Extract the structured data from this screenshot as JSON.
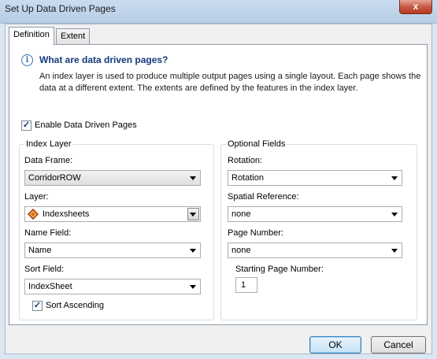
{
  "window": {
    "title": "Set Up Data Driven Pages",
    "close_glyph": "x"
  },
  "tabs": [
    {
      "label": "Definition",
      "active": true
    },
    {
      "label": "Extent",
      "active": false
    }
  ],
  "info": {
    "icon": "info-icon",
    "icon_glyph": "i",
    "heading": "What are data driven pages?",
    "description": "An index layer is used to produce multiple output pages using a single layout.  Each page shows the data at a different extent.  The extents are defined by the features in the index layer."
  },
  "enable": {
    "label": "Enable Data Driven Pages",
    "checked": true,
    "check_glyph": "✓"
  },
  "index_layer": {
    "title": "Index Layer",
    "data_frame": {
      "label": "Data Frame:",
      "value": "CorridorROW"
    },
    "layer": {
      "label": "Layer:",
      "value": "Indexsheets",
      "icon": "polygon-layer-icon"
    },
    "name_field": {
      "label": "Name Field:",
      "value": "Name"
    },
    "sort_field": {
      "label": "Sort Field:",
      "value": "IndexSheet"
    },
    "sort_ascending": {
      "label": "Sort Ascending",
      "checked": true,
      "check_glyph": "✓"
    }
  },
  "optional_fields": {
    "title": "Optional Fields",
    "rotation": {
      "label": "Rotation:",
      "value": "Rotation"
    },
    "spatial_reference": {
      "label": "Spatial Reference:",
      "value": "none"
    },
    "page_number": {
      "label": "Page Number:",
      "value": "none"
    },
    "starting_page": {
      "label": "Starting Page Number:",
      "value": "1"
    }
  },
  "buttons": {
    "ok": "OK",
    "cancel": "Cancel"
  },
  "colors": {
    "heading": "#123a7a",
    "info_icon": "#3d6fb5",
    "close": "#c75b45"
  }
}
